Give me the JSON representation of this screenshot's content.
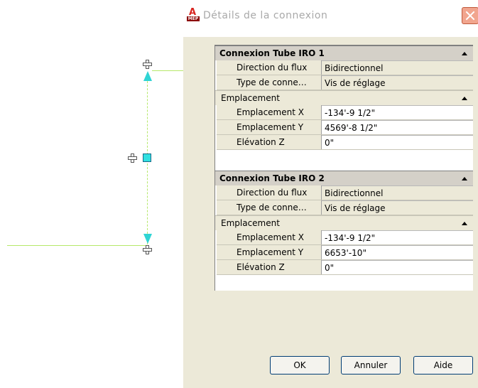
{
  "dialog": {
    "title": "Détails de la connexion",
    "app_icon_text": "MEP"
  },
  "connections": [
    {
      "header": "Connexion Tube IRO 1",
      "flow_label": "Direction du flux",
      "flow_value": "Bidirectionnel",
      "type_label": "Type de conne…",
      "type_value": "Vis de réglage",
      "location_header": "Emplacement",
      "x_label": "Emplacement X",
      "x_value": "-134'-9 1/2\"",
      "y_label": "Emplacement Y",
      "y_value": "4569'-8 1/2\"",
      "z_label": "Elévation Z",
      "z_value": "0\""
    },
    {
      "header": "Connexion Tube IRO 2",
      "flow_label": "Direction du flux",
      "flow_value": "Bidirectionnel",
      "type_label": "Type de conne…",
      "type_value": "Vis de réglage",
      "location_header": "Emplacement",
      "x_label": "Emplacement X",
      "x_value": "-134'-9 1/2\"",
      "y_label": "Emplacement Y",
      "y_value": "6653'-10\"",
      "z_label": "Elévation Z",
      "z_value": "0\""
    }
  ],
  "buttons": {
    "ok": "OK",
    "cancel": "Annuler",
    "help": "Aide"
  },
  "colors": {
    "grip": "#30e0e0",
    "pipe_line": "#b6e86a",
    "close_button": "#f1a58e"
  }
}
